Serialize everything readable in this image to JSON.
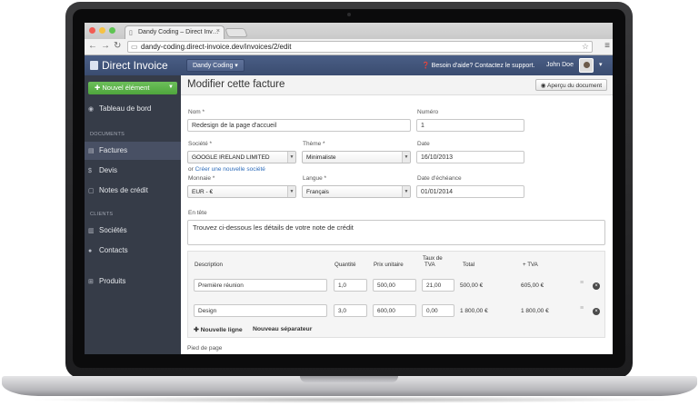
{
  "browser": {
    "tab_title": "Dandy Coding – Direct Inv…",
    "url": "dandy-coding.direct-invoice.dev/invoices/2/edit"
  },
  "colors": {
    "navbar": "#3f5179",
    "sidebar": "#363c48",
    "new_button": "#5cb24a",
    "link": "#2f6dbb"
  },
  "app": {
    "brand": "Direct Invoice",
    "org_dropdown": "Dandy Coding ▾",
    "help": "❓ Besoin d'aide? Contactez le support.",
    "user": "John Doe"
  },
  "sidebar": {
    "new_button": "Nouvel élément",
    "dashboard": "Tableau de bord",
    "section_documents": "DOCUMENTS",
    "items_documents": [
      "Factures",
      "Devis",
      "Notes de crédit"
    ],
    "section_clients": "CLIENTS",
    "items_clients": [
      "Sociétés",
      "Contacts"
    ],
    "products": "Produits"
  },
  "form": {
    "page_title": "Modifier cette facture",
    "preview_button": "Aperçu du document",
    "nom_label": "Nom *",
    "nom_value": "Redesign de la page d'accueil",
    "numero_label": "Numéro",
    "numero_value": "1",
    "societe_label": "Société *",
    "societe_value": "GOOGLE IRELAND LIMITED",
    "theme_label": "Thème *",
    "theme_value": "Minimaliste",
    "date_label": "Date",
    "date_value": "16/10/2013",
    "create_prefix": "or",
    "create_link": "Créer une nouvelle société",
    "monnaie_label": "Monnaie *",
    "monnaie_value": "EUR - €",
    "langue_label": "Langue *",
    "langue_value": "Français",
    "echeance_label": "Date d'échéance",
    "echeance_value": "01/01/2014",
    "entete_label": "En tête",
    "entete_value": "Trouvez ci-dessous les détails de votre note de crédit",
    "footer_label": "Pied de page"
  },
  "table": {
    "headers": {
      "description": "Description",
      "quantite": "Quantité",
      "prix": "Prix unitaire",
      "tva_line1": "Taux de",
      "tva_line2": "TVA",
      "total": "Total",
      "plus_tva": "+ TVA"
    },
    "rows": [
      {
        "description": "Première réunion",
        "quantite": "1,0",
        "prix": "500,00",
        "tva": "21,00",
        "total": "500,00 €",
        "plus_tva": "605,00 €"
      },
      {
        "description": "Design",
        "quantite": "3,0",
        "prix": "600,00",
        "tva": "0,00",
        "total": "1 800,00 €",
        "plus_tva": "1 800,00 €"
      }
    ],
    "add_line": "Nouvelle ligne",
    "add_separator": "Nouveau séparateur"
  }
}
